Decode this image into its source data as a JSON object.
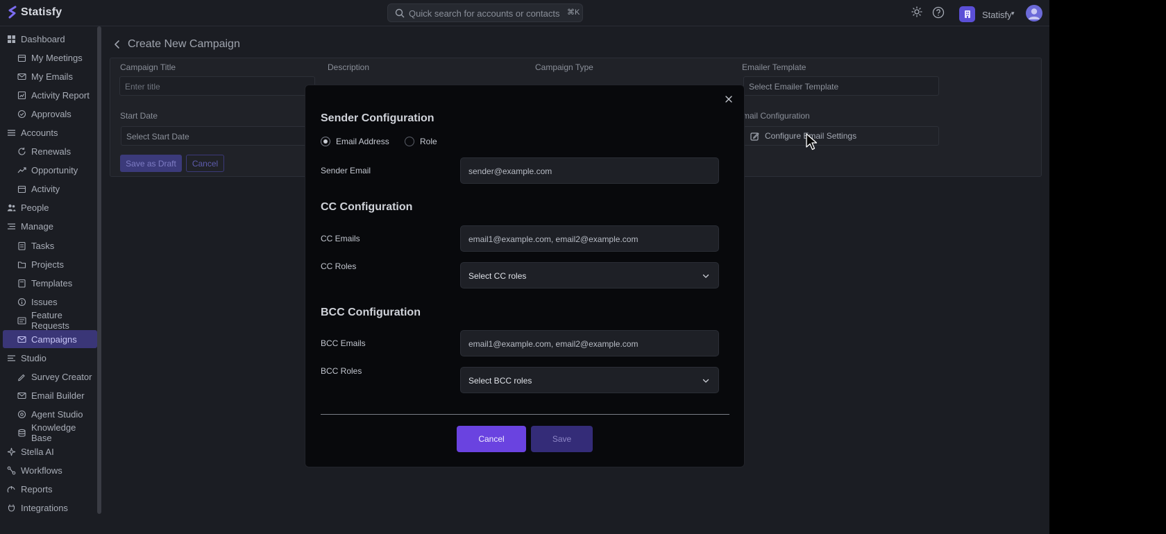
{
  "app": {
    "name": "Statisfy"
  },
  "topbar": {
    "search_placeholder": "Quick search for accounts or contacts",
    "search_shortcut": "⌘K",
    "org_name": "Statisfy"
  },
  "sidebar": {
    "items": [
      {
        "label": "Dashboard",
        "icon": "dashboard-icon",
        "level": "top"
      },
      {
        "label": "My Meetings",
        "icon": "calendar-icon",
        "level": "sub"
      },
      {
        "label": "My Emails",
        "icon": "mail-icon",
        "level": "sub"
      },
      {
        "label": "Activity Report",
        "icon": "report-icon",
        "level": "sub"
      },
      {
        "label": "Approvals",
        "icon": "check-circle-icon",
        "level": "sub"
      },
      {
        "label": "Accounts",
        "icon": "list-icon",
        "level": "top"
      },
      {
        "label": "Renewals",
        "icon": "refresh-icon",
        "level": "sub"
      },
      {
        "label": "Opportunity",
        "icon": "trend-icon",
        "level": "sub"
      },
      {
        "label": "Activity",
        "icon": "calendar-icon",
        "level": "sub"
      },
      {
        "label": "People",
        "icon": "people-icon",
        "level": "top"
      },
      {
        "label": "Manage",
        "icon": "manage-icon",
        "level": "top"
      },
      {
        "label": "Tasks",
        "icon": "tasks-icon",
        "level": "sub"
      },
      {
        "label": "Projects",
        "icon": "folder-icon",
        "level": "sub"
      },
      {
        "label": "Templates",
        "icon": "template-icon",
        "level": "sub"
      },
      {
        "label": "Issues",
        "icon": "info-icon",
        "level": "sub"
      },
      {
        "label": "Feature Requests",
        "icon": "feature-icon",
        "level": "sub"
      },
      {
        "label": "Campaigns",
        "icon": "mail-icon",
        "level": "sub",
        "active": true
      },
      {
        "label": "Studio",
        "icon": "studio-icon",
        "level": "top"
      },
      {
        "label": "Survey Creator",
        "icon": "survey-icon",
        "level": "sub"
      },
      {
        "label": "Email Builder",
        "icon": "mail-icon",
        "level": "sub"
      },
      {
        "label": "Agent Studio",
        "icon": "agent-icon",
        "level": "sub"
      },
      {
        "label": "Knowledge Base",
        "icon": "database-icon",
        "level": "sub"
      },
      {
        "label": "Stella AI",
        "icon": "sparkle-icon",
        "level": "top"
      },
      {
        "label": "Workflows",
        "icon": "workflow-icon",
        "level": "top"
      },
      {
        "label": "Reports",
        "icon": "reports-icon",
        "level": "top"
      },
      {
        "label": "Integrations",
        "icon": "plug-icon",
        "level": "top"
      }
    ]
  },
  "page": {
    "title": "Create New Campaign",
    "fields": {
      "campaign_title_label": "Campaign Title",
      "campaign_title_placeholder": "Enter title",
      "description_label": "Description",
      "campaign_type_label": "Campaign Type",
      "emailer_template_label": "Emailer Template",
      "emailer_template_placeholder": "Select Emailer Template",
      "start_date_label": "Start Date",
      "start_date_placeholder": "Select Start Date",
      "email_configuration_label": "Email Configuration",
      "configure_button": "Configure Email Settings"
    },
    "save_draft": "Save as Draft",
    "cancel": "Cancel"
  },
  "modal": {
    "sender_heading": "Sender Configuration",
    "radio_email": "Email Address",
    "radio_role": "Role",
    "radio_selected": "Email Address",
    "sender_email_label": "Sender Email",
    "sender_email_value": "sender@example.com",
    "cc_heading": "CC Configuration",
    "cc_emails_label": "CC Emails",
    "cc_emails_placeholder": "email1@example.com, email2@example.com",
    "cc_roles_label": "CC Roles",
    "cc_roles_select": "Select CC roles",
    "bcc_heading": "BCC Configuration",
    "bcc_emails_label": "BCC Emails",
    "bcc_emails_placeholder": "email1@example.com, email2@example.com",
    "bcc_roles_label": "BCC Roles",
    "bcc_roles_select": "Select BCC roles",
    "cancel": "Cancel",
    "save": "Save"
  }
}
